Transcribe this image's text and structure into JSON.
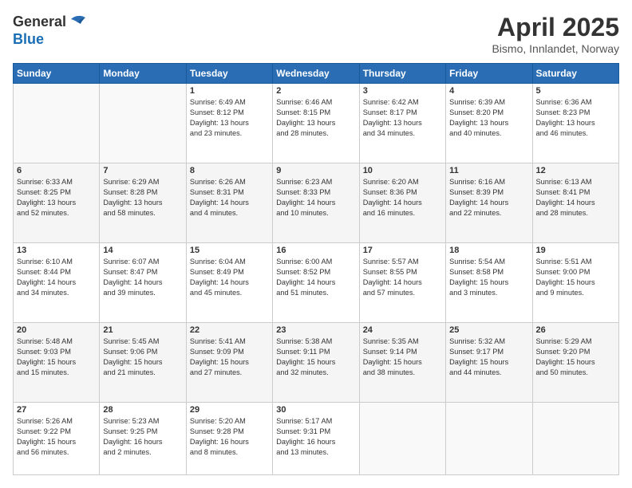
{
  "logo": {
    "general": "General",
    "blue": "Blue"
  },
  "header": {
    "title": "April 2025",
    "location": "Bismo, Innlandet, Norway"
  },
  "weekdays": [
    "Sunday",
    "Monday",
    "Tuesday",
    "Wednesday",
    "Thursday",
    "Friday",
    "Saturday"
  ],
  "rows": [
    [
      {
        "day": "",
        "info": ""
      },
      {
        "day": "",
        "info": ""
      },
      {
        "day": "1",
        "info": "Sunrise: 6:49 AM\nSunset: 8:12 PM\nDaylight: 13 hours\nand 23 minutes."
      },
      {
        "day": "2",
        "info": "Sunrise: 6:46 AM\nSunset: 8:15 PM\nDaylight: 13 hours\nand 28 minutes."
      },
      {
        "day": "3",
        "info": "Sunrise: 6:42 AM\nSunset: 8:17 PM\nDaylight: 13 hours\nand 34 minutes."
      },
      {
        "day": "4",
        "info": "Sunrise: 6:39 AM\nSunset: 8:20 PM\nDaylight: 13 hours\nand 40 minutes."
      },
      {
        "day": "5",
        "info": "Sunrise: 6:36 AM\nSunset: 8:23 PM\nDaylight: 13 hours\nand 46 minutes."
      }
    ],
    [
      {
        "day": "6",
        "info": "Sunrise: 6:33 AM\nSunset: 8:25 PM\nDaylight: 13 hours\nand 52 minutes."
      },
      {
        "day": "7",
        "info": "Sunrise: 6:29 AM\nSunset: 8:28 PM\nDaylight: 13 hours\nand 58 minutes."
      },
      {
        "day": "8",
        "info": "Sunrise: 6:26 AM\nSunset: 8:31 PM\nDaylight: 14 hours\nand 4 minutes."
      },
      {
        "day": "9",
        "info": "Sunrise: 6:23 AM\nSunset: 8:33 PM\nDaylight: 14 hours\nand 10 minutes."
      },
      {
        "day": "10",
        "info": "Sunrise: 6:20 AM\nSunset: 8:36 PM\nDaylight: 14 hours\nand 16 minutes."
      },
      {
        "day": "11",
        "info": "Sunrise: 6:16 AM\nSunset: 8:39 PM\nDaylight: 14 hours\nand 22 minutes."
      },
      {
        "day": "12",
        "info": "Sunrise: 6:13 AM\nSunset: 8:41 PM\nDaylight: 14 hours\nand 28 minutes."
      }
    ],
    [
      {
        "day": "13",
        "info": "Sunrise: 6:10 AM\nSunset: 8:44 PM\nDaylight: 14 hours\nand 34 minutes."
      },
      {
        "day": "14",
        "info": "Sunrise: 6:07 AM\nSunset: 8:47 PM\nDaylight: 14 hours\nand 39 minutes."
      },
      {
        "day": "15",
        "info": "Sunrise: 6:04 AM\nSunset: 8:49 PM\nDaylight: 14 hours\nand 45 minutes."
      },
      {
        "day": "16",
        "info": "Sunrise: 6:00 AM\nSunset: 8:52 PM\nDaylight: 14 hours\nand 51 minutes."
      },
      {
        "day": "17",
        "info": "Sunrise: 5:57 AM\nSunset: 8:55 PM\nDaylight: 14 hours\nand 57 minutes."
      },
      {
        "day": "18",
        "info": "Sunrise: 5:54 AM\nSunset: 8:58 PM\nDaylight: 15 hours\nand 3 minutes."
      },
      {
        "day": "19",
        "info": "Sunrise: 5:51 AM\nSunset: 9:00 PM\nDaylight: 15 hours\nand 9 minutes."
      }
    ],
    [
      {
        "day": "20",
        "info": "Sunrise: 5:48 AM\nSunset: 9:03 PM\nDaylight: 15 hours\nand 15 minutes."
      },
      {
        "day": "21",
        "info": "Sunrise: 5:45 AM\nSunset: 9:06 PM\nDaylight: 15 hours\nand 21 minutes."
      },
      {
        "day": "22",
        "info": "Sunrise: 5:41 AM\nSunset: 9:09 PM\nDaylight: 15 hours\nand 27 minutes."
      },
      {
        "day": "23",
        "info": "Sunrise: 5:38 AM\nSunset: 9:11 PM\nDaylight: 15 hours\nand 32 minutes."
      },
      {
        "day": "24",
        "info": "Sunrise: 5:35 AM\nSunset: 9:14 PM\nDaylight: 15 hours\nand 38 minutes."
      },
      {
        "day": "25",
        "info": "Sunrise: 5:32 AM\nSunset: 9:17 PM\nDaylight: 15 hours\nand 44 minutes."
      },
      {
        "day": "26",
        "info": "Sunrise: 5:29 AM\nSunset: 9:20 PM\nDaylight: 15 hours\nand 50 minutes."
      }
    ],
    [
      {
        "day": "27",
        "info": "Sunrise: 5:26 AM\nSunset: 9:22 PM\nDaylight: 15 hours\nand 56 minutes."
      },
      {
        "day": "28",
        "info": "Sunrise: 5:23 AM\nSunset: 9:25 PM\nDaylight: 16 hours\nand 2 minutes."
      },
      {
        "day": "29",
        "info": "Sunrise: 5:20 AM\nSunset: 9:28 PM\nDaylight: 16 hours\nand 8 minutes."
      },
      {
        "day": "30",
        "info": "Sunrise: 5:17 AM\nSunset: 9:31 PM\nDaylight: 16 hours\nand 13 minutes."
      },
      {
        "day": "",
        "info": ""
      },
      {
        "day": "",
        "info": ""
      },
      {
        "day": "",
        "info": ""
      }
    ]
  ]
}
